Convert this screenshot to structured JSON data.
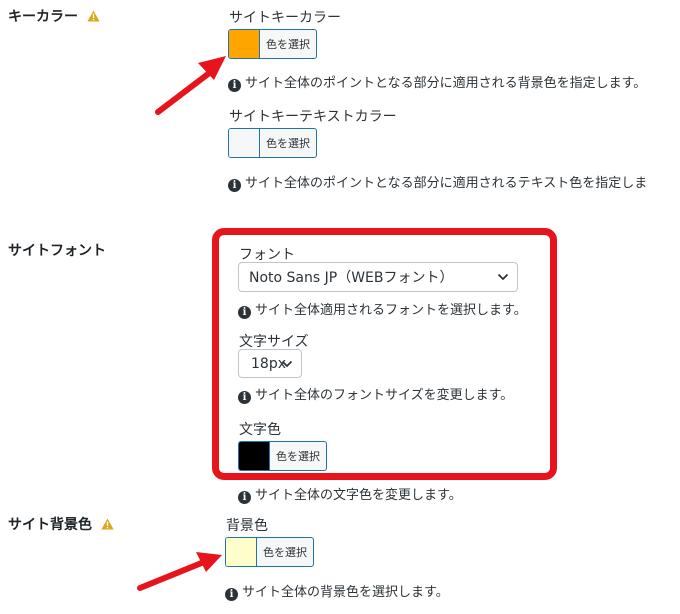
{
  "key_color": {
    "title": "キーカラー",
    "site_key_color": {
      "label": "サイトキーカラー",
      "swatch": "#ffa500",
      "button_text": "色を選択",
      "help": "サイト全体のポイントとなる部分に適用される背景色を指定します。"
    },
    "site_key_text_color": {
      "label": "サイトキーテキストカラー",
      "swatch": "#f6f7f7",
      "button_text": "色を選択",
      "help": "サイト全体のポイントとなる部分に適用されるテキスト色を指定しま"
    }
  },
  "site_font": {
    "title": "サイトフォント",
    "font": {
      "label": "フォント",
      "selected": "Noto Sans JP（WEBフォント）",
      "help": "サイト全体適用されるフォントを選択します。"
    },
    "font_size": {
      "label": "文字サイズ",
      "selected": "18px",
      "help": "サイト全体のフォントサイズを変更します。"
    },
    "text_color": {
      "label": "文字色",
      "swatch": "#000000",
      "button_text": "色を選択",
      "help": "サイト全体の文字色を変更します。"
    }
  },
  "site_bg": {
    "title": "サイト背景色",
    "bg_color": {
      "label": "背景色",
      "swatch": "#ffffcc",
      "button_text": "色を選択",
      "help": "サイト全体の背景色を選択します。"
    }
  },
  "colors": {
    "highlight": "#e8141c",
    "warning": "#dba617",
    "button_border": "#2271b1"
  }
}
